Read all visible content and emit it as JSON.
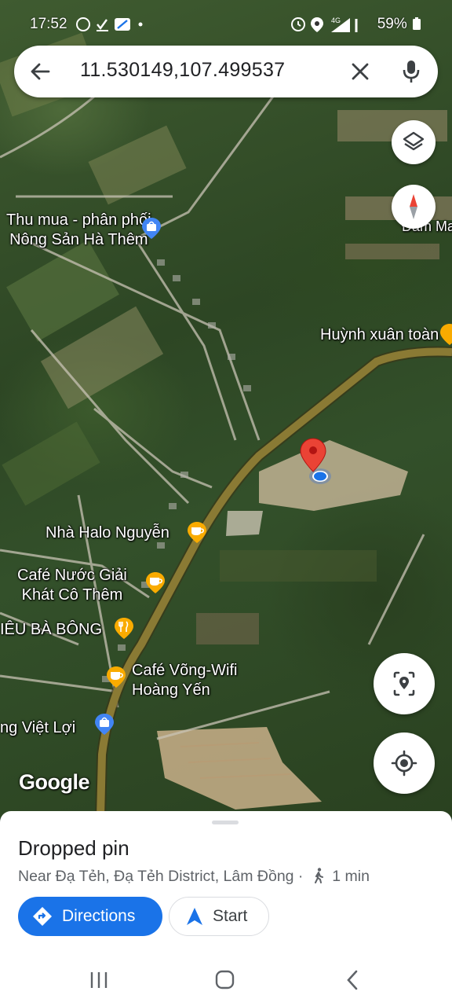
{
  "status_bar": {
    "time": "17:52",
    "network": "4G",
    "battery": "59%"
  },
  "search": {
    "query": "11.530149,107.499537"
  },
  "map": {
    "pois": [
      {
        "name": "Thu mua - phân phối\nNông Sản Hà Thêm",
        "icon": "shopping-bag-icon",
        "color": "#4285f4"
      },
      {
        "name": "Đam Ma",
        "icon": "",
        "color": ""
      },
      {
        "name": "Huỳnh xuân toàn",
        "icon": "cafe-icon",
        "color": "#f9ab00"
      },
      {
        "name": "Nhà Halo Nguyễn",
        "icon": "cafe-icon",
        "color": "#f9ab00"
      },
      {
        "name": "Café Nước Giải\nKhát Cô Thêm",
        "icon": "cafe-icon",
        "color": "#f9ab00"
      },
      {
        "name": "IÊU BÀ BÔNG",
        "icon": "restaurant-icon",
        "color": "#f9ab00"
      },
      {
        "name": "Café Võng-Wifi\nHoàng Yến",
        "icon": "cafe-icon",
        "color": "#f9ab00"
      },
      {
        "name": "ng Việt Lợi",
        "icon": "shopping-bag-icon",
        "color": "#4285f4"
      }
    ],
    "logo": "Google",
    "pin_color": "#ea4335",
    "road_color": "#7a6a2a"
  },
  "sheet": {
    "title": "Dropped pin",
    "subtitle": "Near Đạ Tẻh, Đạ Tẻh District, Lâm Đồng ·",
    "walk_time": "1 min",
    "directions_label": "Directions",
    "start_label": "Start"
  }
}
